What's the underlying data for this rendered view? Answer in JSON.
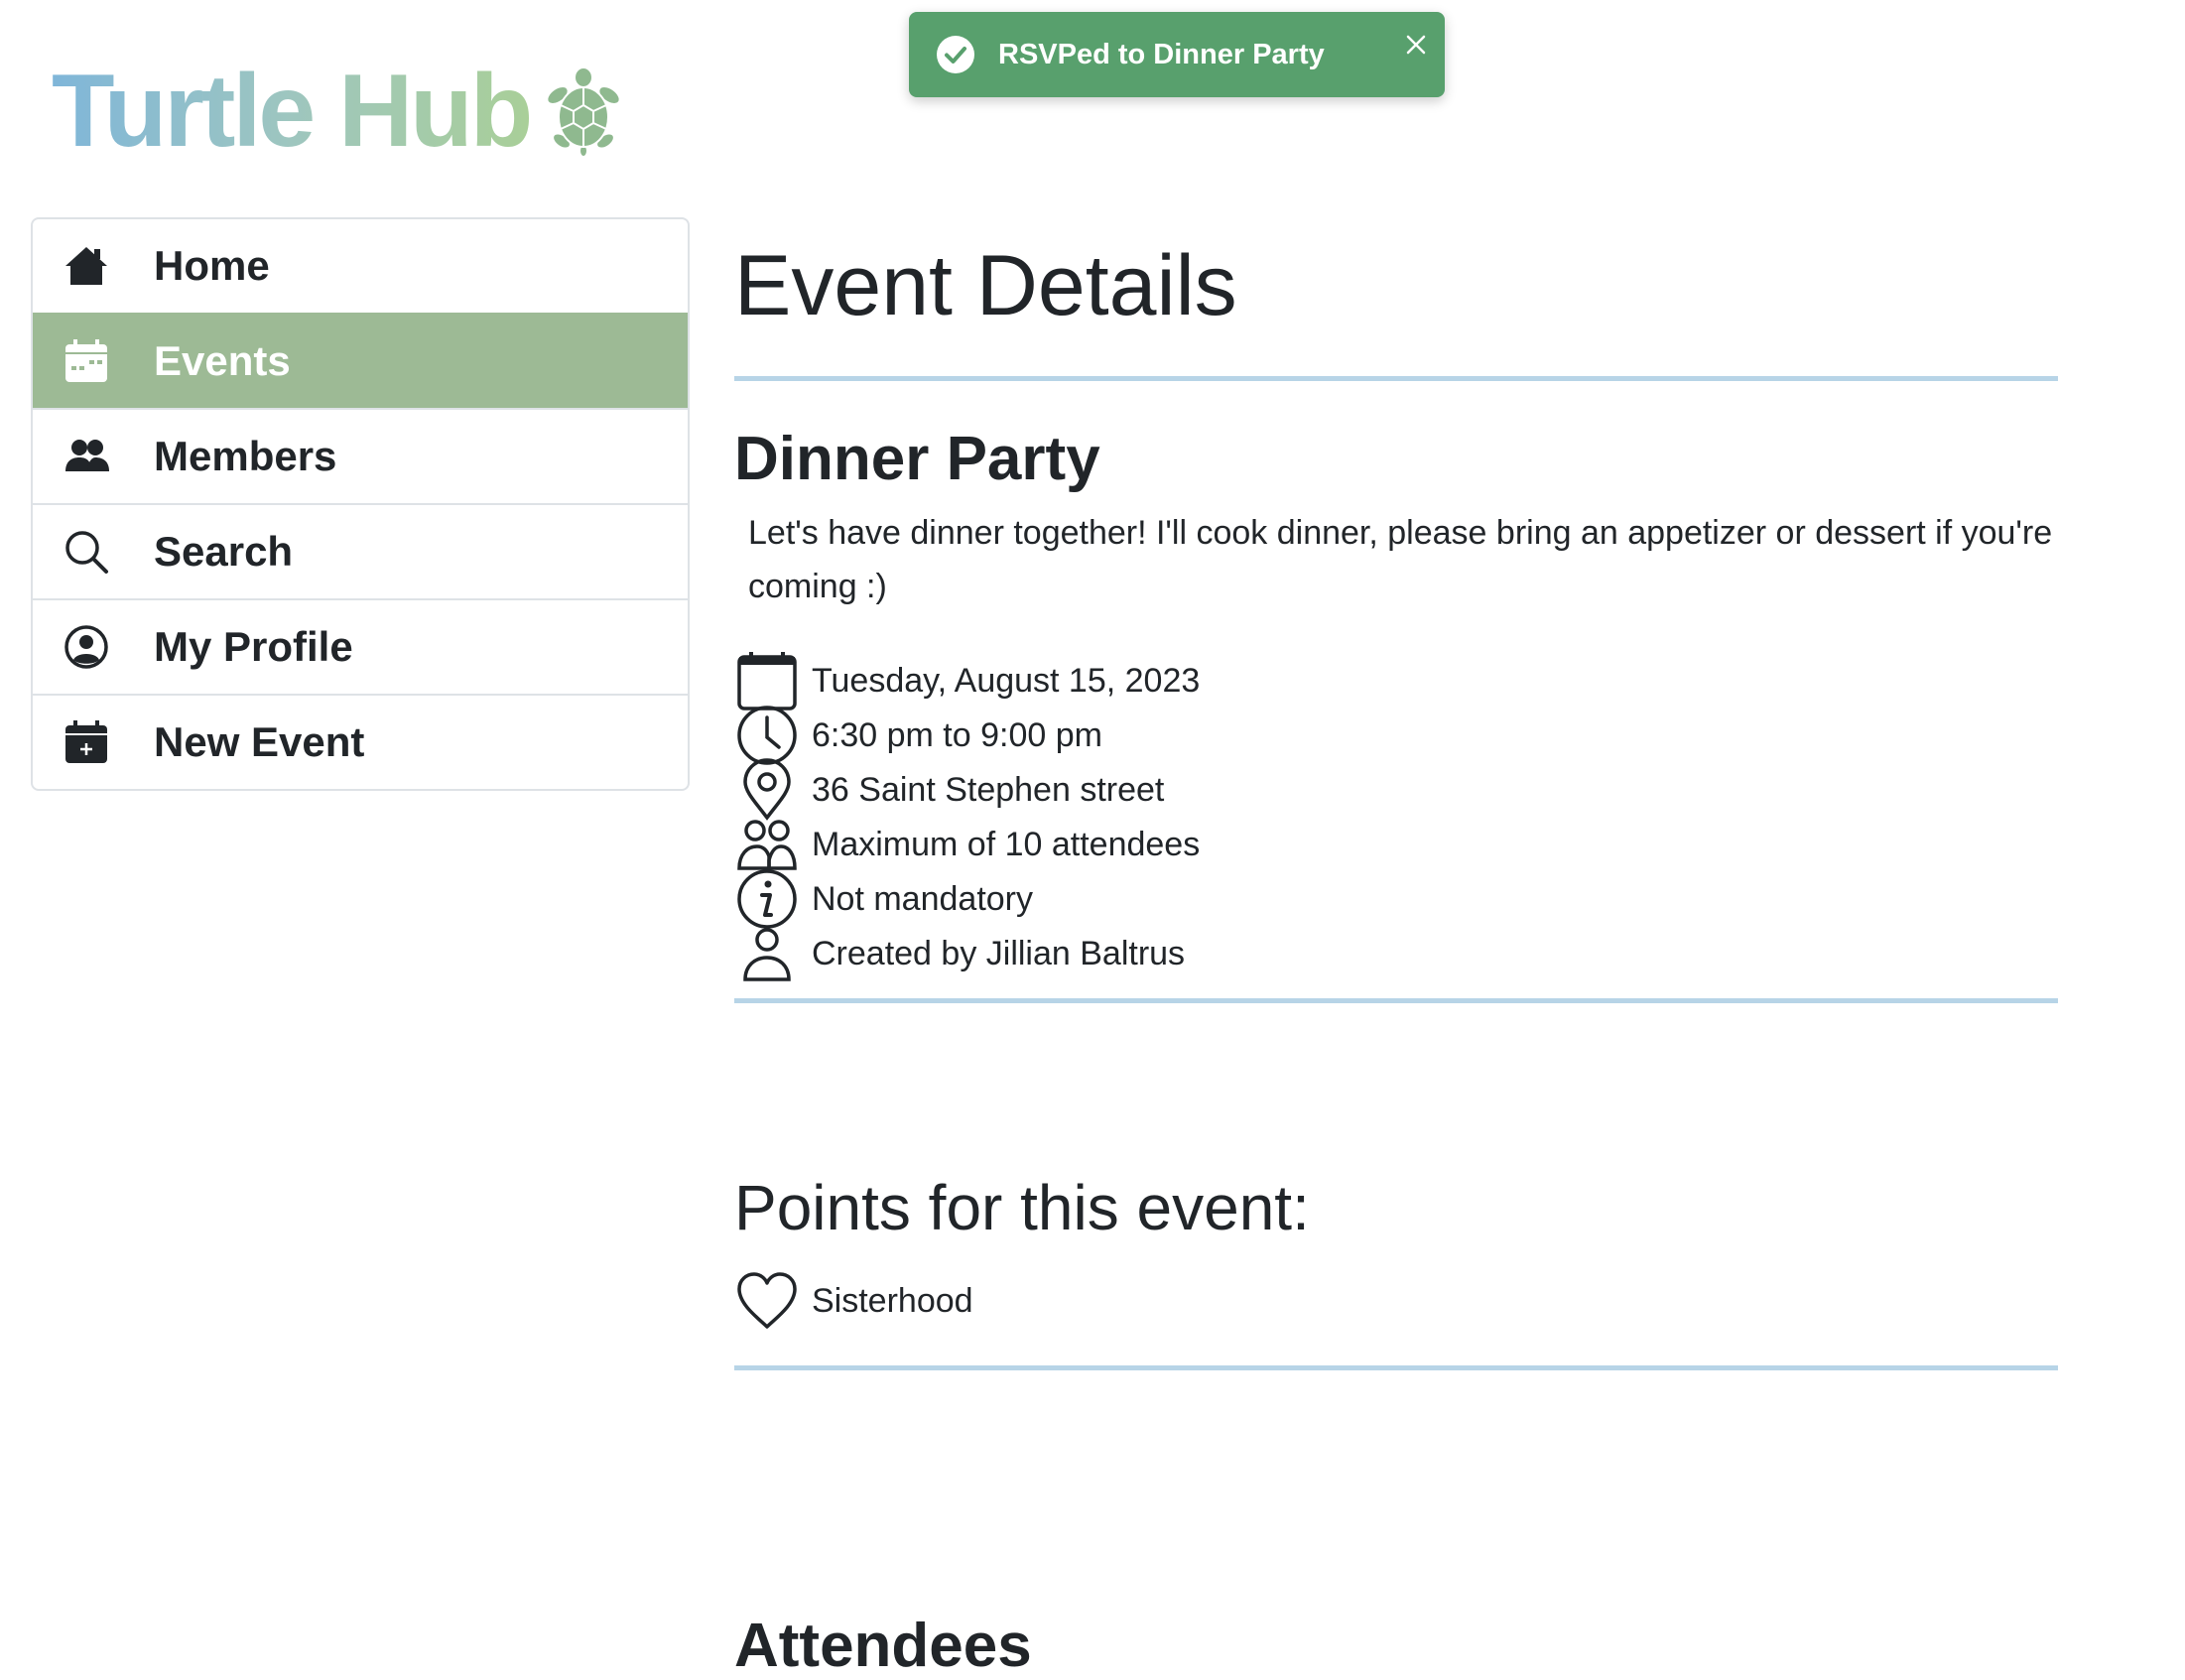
{
  "app": {
    "logo_text": "Turtle Hub",
    "brand_colors": [
      "#7fb6d9",
      "#a9cf98"
    ]
  },
  "toast": {
    "message": "RSVPed to Dinner Party",
    "background": "#58a06d",
    "icons": [
      "check-circle-icon",
      "close-icon"
    ]
  },
  "sidebar": {
    "active_color": "#9dba95",
    "items": [
      {
        "label": "Home",
        "icon": "house-icon"
      },
      {
        "label": "Events",
        "icon": "calendar-icon",
        "active": true
      },
      {
        "label": "Members",
        "icon": "people-icon"
      },
      {
        "label": "Search",
        "icon": "search-icon"
      },
      {
        "label": "My Profile",
        "icon": "person-circle-icon"
      },
      {
        "label": "New Event",
        "icon": "calendar-plus-icon"
      }
    ]
  },
  "main": {
    "page_title": "Event Details",
    "event": {
      "title": "Dinner Party",
      "description": "Let's have dinner together! I'll cook dinner, please bring an appetizer or dessert if you're coming :)",
      "details": [
        {
          "icon": "calendar-icon",
          "text": "Tuesday, August 15, 2023"
        },
        {
          "icon": "clock-icon",
          "text": "6:30 pm to 9:00 pm"
        },
        {
          "icon": "location-pin-icon",
          "text": "36 Saint Stephen street"
        },
        {
          "icon": "people-icon",
          "text": "Maximum of 10 attendees"
        },
        {
          "icon": "info-icon",
          "text": "Not mandatory"
        },
        {
          "icon": "person-icon",
          "text": "Created by Jillian Baltrus"
        }
      ]
    },
    "points_title": "Points for this event:",
    "points": [
      {
        "icon": "heart-icon",
        "text": "Sisterhood"
      }
    ],
    "next_section_title": "Attendees"
  }
}
